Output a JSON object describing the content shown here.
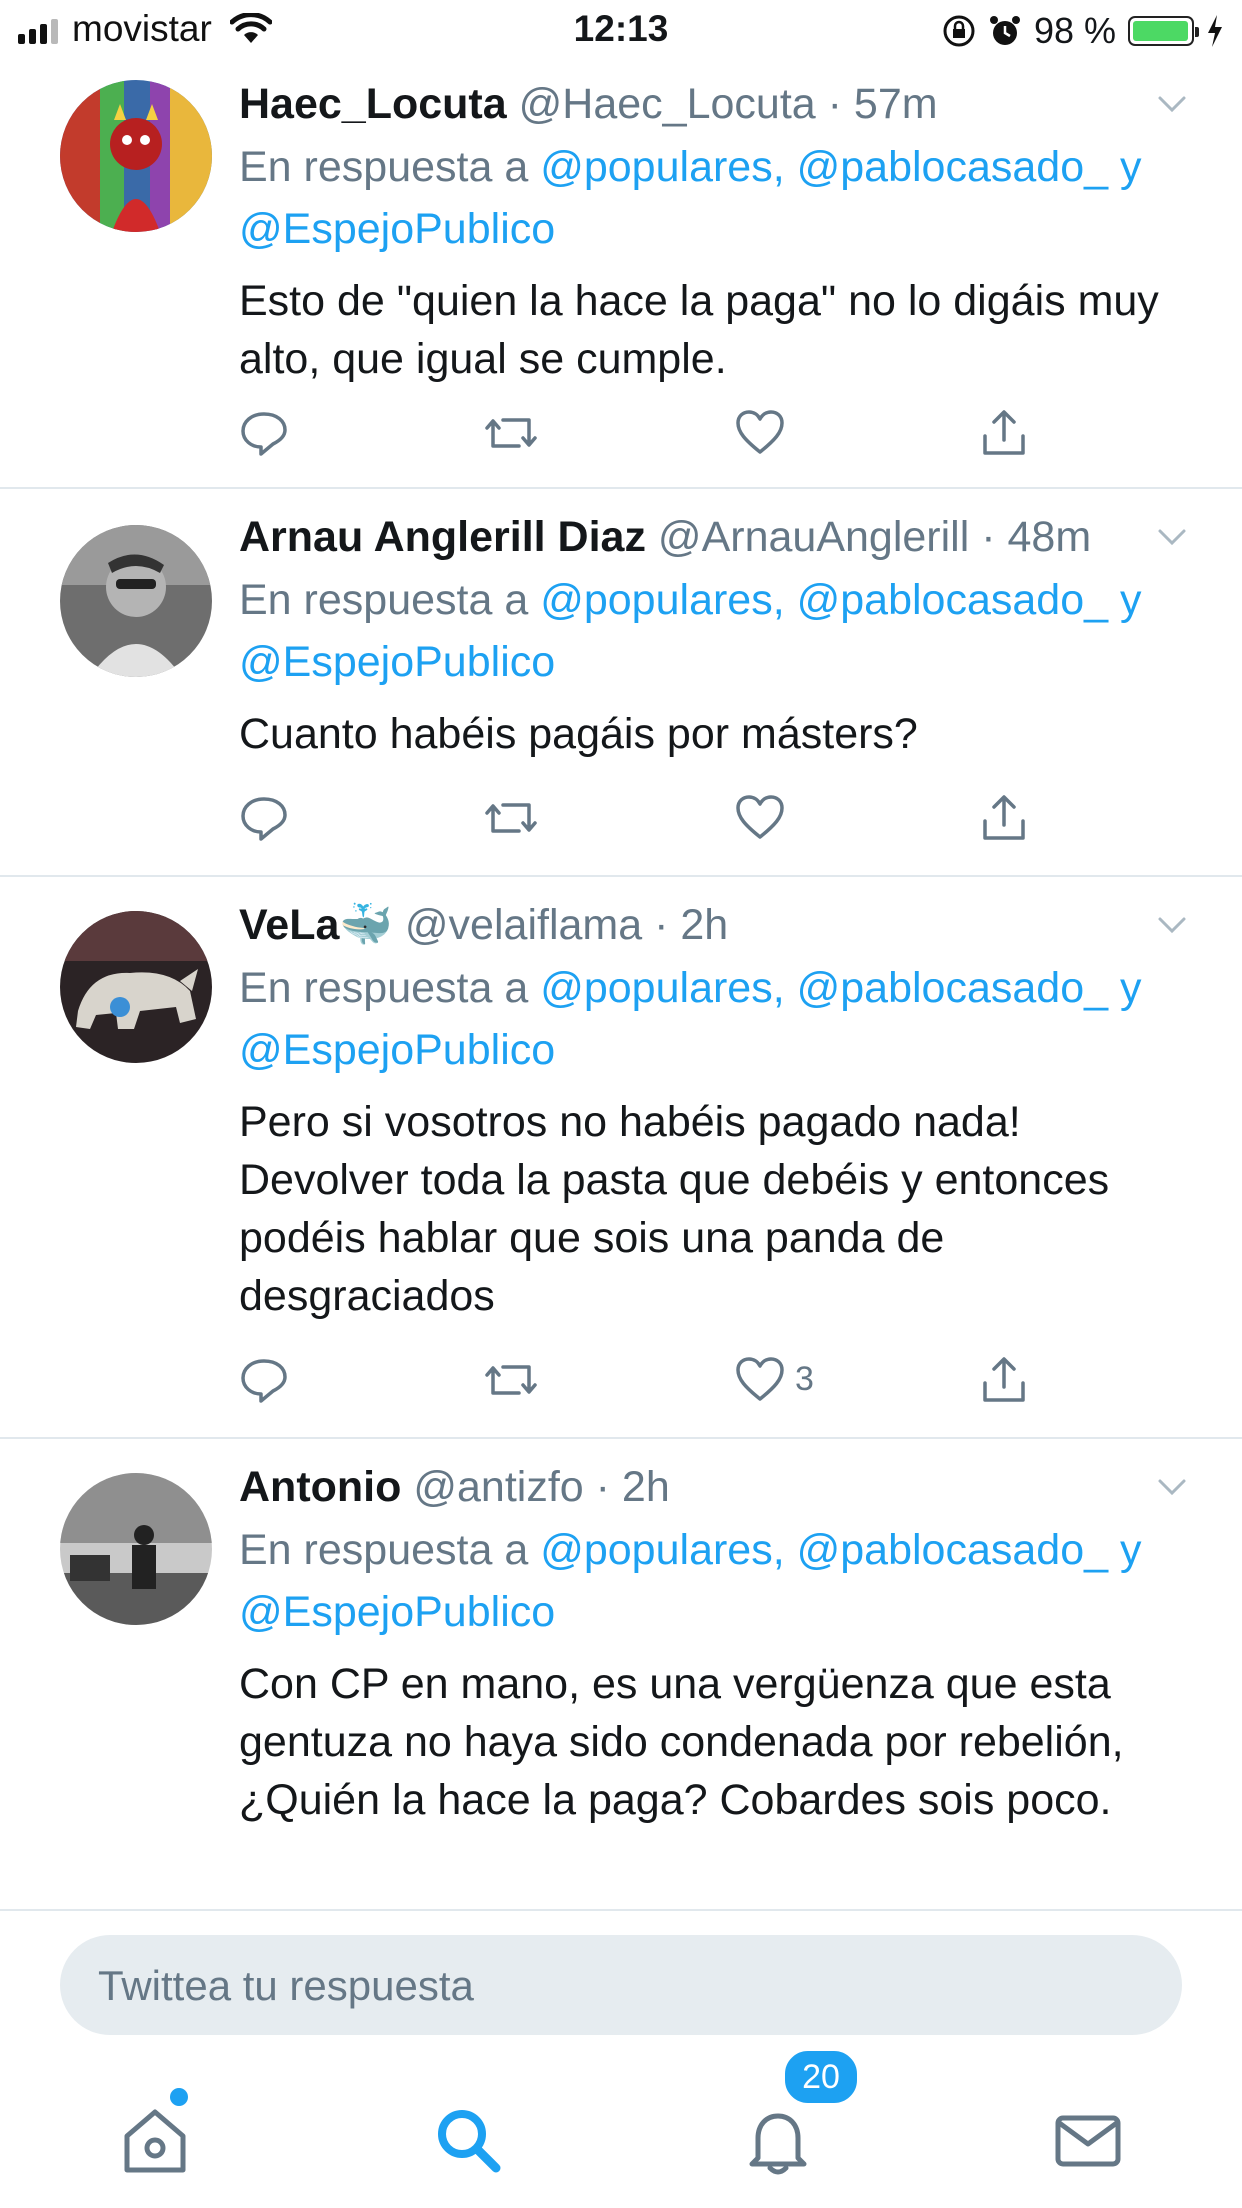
{
  "status_bar": {
    "carrier": "movistar",
    "time": "12:13",
    "battery_percent": "98 %",
    "battery_level": 0.98
  },
  "tweets": [
    {
      "name": "Haec_Locuta",
      "handle": "@Haec_Locuta",
      "time": "57m",
      "reply_prefix": "En respuesta a",
      "mentions_line1": "@populares, @pablocasado_",
      "conj": "y",
      "mentions_line2": "@EspejoPublico",
      "text": "Esto de \"quien la hace la paga\" no lo digáis muy alto, que igual se cumple.",
      "likes": ""
    },
    {
      "name": "Arnau Anglerill Diaz",
      "handle": "@ArnauAnglerill",
      "time": "48m",
      "reply_prefix": "En respuesta a",
      "mentions_line1": "@populares, @pablocasado_",
      "conj": "y",
      "mentions_line2": "@EspejoPublico",
      "text": "Cuanto habéis pagáis por másters?",
      "likes": ""
    },
    {
      "name": "VeLa",
      "name_emoji": "🐳",
      "handle": "@velaiflama",
      "time": "2h",
      "reply_prefix": "En respuesta a",
      "mentions_line1": "@populares, @pablocasado_",
      "conj": "y",
      "mentions_line2": "@EspejoPublico",
      "text": "Pero si vosotros no habéis pagado nada! Devolver toda la pasta que debéis y entonces podéis hablar que sois una panda de desgraciados",
      "likes": "3"
    },
    {
      "name": "Antonio",
      "handle": "@antizfo",
      "time": "2h",
      "reply_prefix": "En respuesta a",
      "mentions_line1": "@populares, @pablocasado_",
      "conj": "y",
      "mentions_line2": "@EspejoPublico",
      "text": "Con CP en mano, es una vergüenza que esta gentuza no haya sido condenada por rebelión, ¿Quién la hace la paga? Cobardes sois poco."
    }
  ],
  "reply_bar": {
    "placeholder": "Twittea tu respuesta"
  },
  "tab_bar": {
    "notifications_badge": "20"
  },
  "colors": {
    "accent": "#1da1f2",
    "muted": "#657786",
    "text": "#14171a",
    "divider": "#e1e8ed"
  }
}
